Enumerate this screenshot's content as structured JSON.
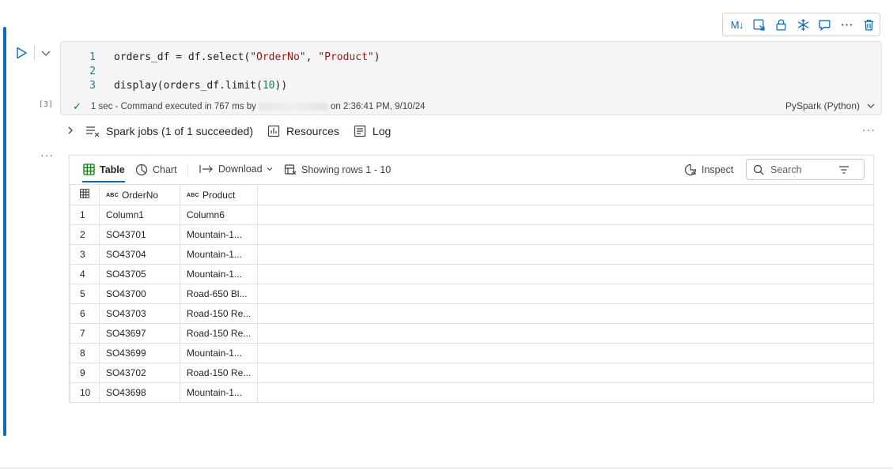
{
  "cell_toolbar": {
    "markdown_label": "M↓",
    "icons": [
      "convert-cell-icon",
      "lock-icon",
      "freeze-icon",
      "comment-icon",
      "more-icon",
      "delete-icon"
    ]
  },
  "code": {
    "lines": [
      {
        "num": "1",
        "text": "orders_df = df.select(\"OrderNo\", \"Product\")"
      },
      {
        "num": "2",
        "text": ""
      },
      {
        "num": "3",
        "text": "display(orders_df.limit(10))"
      }
    ],
    "exec_count": "[3]",
    "status_prefix": "1 sec - Command executed in 767 ms by",
    "status_suffix": "on 2:36:41 PM, 9/10/24",
    "language": "PySpark (Python)"
  },
  "spark": {
    "jobs_label": "Spark jobs (1 of 1 succeeded)",
    "resources_label": "Resources",
    "log_label": "Log",
    "more": "···"
  },
  "output": {
    "more": "···",
    "toolbar": {
      "table_label": "Table",
      "chart_label": "Chart",
      "download_label": "Download",
      "rows_label": "Showing rows 1 - 10",
      "inspect_label": "Inspect",
      "search_placeholder": "Search"
    },
    "table": {
      "type_badge": "ABC",
      "columns": [
        "OrderNo",
        "Product"
      ],
      "rows": [
        [
          "1",
          "Column1",
          "Column6"
        ],
        [
          "2",
          "SO43701",
          "Mountain-1..."
        ],
        [
          "3",
          "SO43704",
          "Mountain-1..."
        ],
        [
          "4",
          "SO43705",
          "Mountain-1..."
        ],
        [
          "5",
          "SO43700",
          "Road-650 Bl..."
        ],
        [
          "6",
          "SO43703",
          "Road-150 Re..."
        ],
        [
          "7",
          "SO43697",
          "Road-150 Re..."
        ],
        [
          "8",
          "SO43699",
          "Mountain-1..."
        ],
        [
          "9",
          "SO43702",
          "Road-150 Re..."
        ],
        [
          "10",
          "SO43698",
          "Mountain-1..."
        ]
      ]
    }
  },
  "colors": {
    "accent": "#0f6cbd",
    "success": "#107c10",
    "string": "#a31515",
    "number": "#098658"
  }
}
